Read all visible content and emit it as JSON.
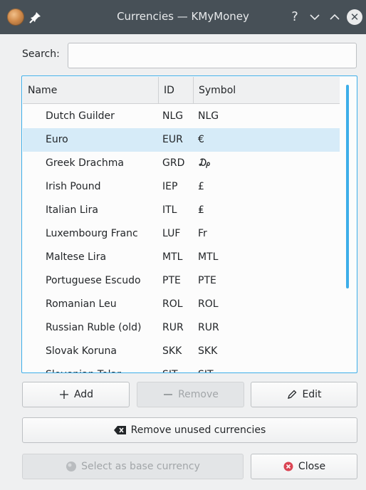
{
  "window": {
    "title": "Currencies — KMyMoney",
    "help_glyph": "?"
  },
  "search": {
    "label": "Search:",
    "value": "",
    "placeholder": ""
  },
  "table": {
    "columns": [
      "Name",
      "ID",
      "Symbol"
    ],
    "rows": [
      {
        "name": "Dutch Guilder",
        "id": "NLG",
        "symbol": "NLG",
        "selected": false
      },
      {
        "name": "Euro",
        "id": "EUR",
        "symbol": "€",
        "selected": true
      },
      {
        "name": "Greek Drachma",
        "id": "GRD",
        "symbol": "₯",
        "selected": false
      },
      {
        "name": "Irish Pound",
        "id": "IEP",
        "symbol": "£",
        "selected": false
      },
      {
        "name": "Italian Lira",
        "id": "ITL",
        "symbol": "₤",
        "selected": false
      },
      {
        "name": "Luxembourg Franc",
        "id": "LUF",
        "symbol": "Fr",
        "selected": false
      },
      {
        "name": "Maltese Lira",
        "id": "MTL",
        "symbol": "MTL",
        "selected": false
      },
      {
        "name": "Portuguese Escudo",
        "id": "PTE",
        "symbol": "PTE",
        "selected": false
      },
      {
        "name": "Romanian Leu",
        "id": "ROL",
        "symbol": "ROL",
        "selected": false
      },
      {
        "name": "Russian Ruble (old)",
        "id": "RUR",
        "symbol": "RUR",
        "selected": false
      },
      {
        "name": "Slovak Koruna",
        "id": "SKK",
        "symbol": "SKK",
        "selected": false
      },
      {
        "name": "Slovenian Tolar",
        "id": "SIT",
        "symbol": "SIT",
        "selected": false
      }
    ]
  },
  "buttons": {
    "add": "Add",
    "remove": "Remove",
    "edit": "Edit",
    "remove_unused": "Remove unused currencies",
    "select_base": "Select as base currency",
    "close": "Close"
  },
  "icons": {
    "add": "plus-icon",
    "remove": "minus-icon",
    "edit": "pencil-icon",
    "remove_unused": "backspace-icon",
    "select_base": "coin-icon",
    "close": "close-circle-icon"
  },
  "colors": {
    "titlebar": "#475057",
    "accent": "#3daee9",
    "selection": "#d6ebf8",
    "close_icon": "#da4453"
  }
}
